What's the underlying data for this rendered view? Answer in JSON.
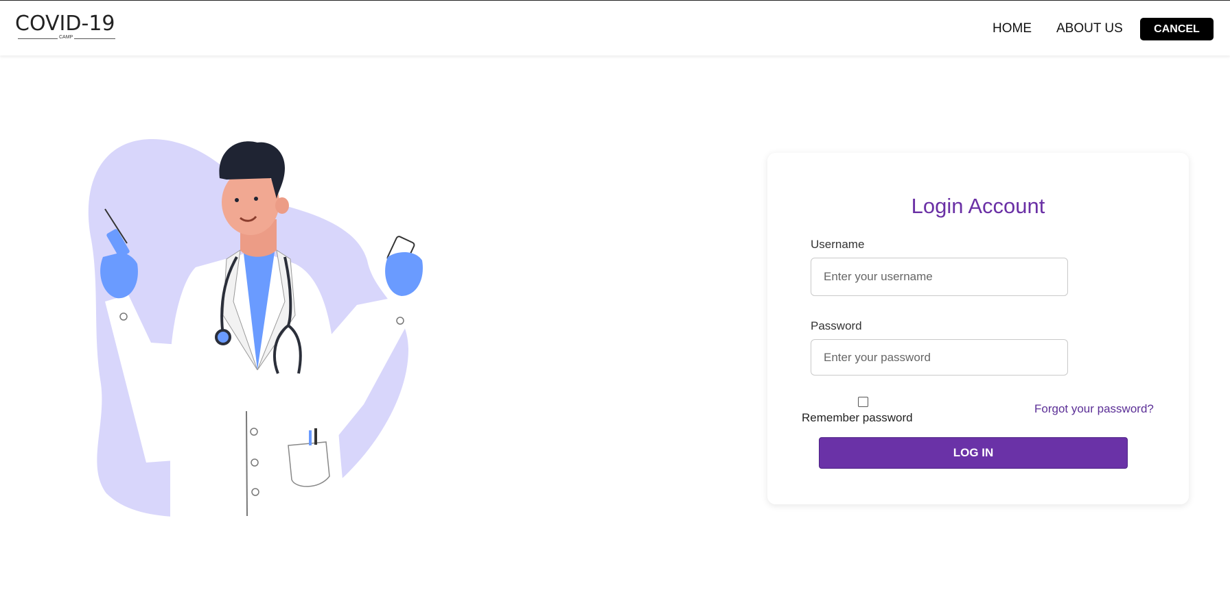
{
  "header": {
    "logo_text": "COVID-19",
    "logo_sub": "CAMP",
    "nav": {
      "home": "HOME",
      "about": "ABOUT US",
      "cancel": "CANCEL"
    }
  },
  "login": {
    "title": "Login Account",
    "username_label": "Username",
    "username_placeholder": "Enter your username",
    "password_label": "Password",
    "password_placeholder": "Enter your password",
    "remember_label": "Remember password",
    "forgot_label": "Forgot your password?",
    "submit_label": "LOG IN"
  },
  "colors": {
    "accent": "#6a32a7",
    "illustration_blob": "#d8d6fb",
    "glove_blue": "#6a9bff"
  }
}
